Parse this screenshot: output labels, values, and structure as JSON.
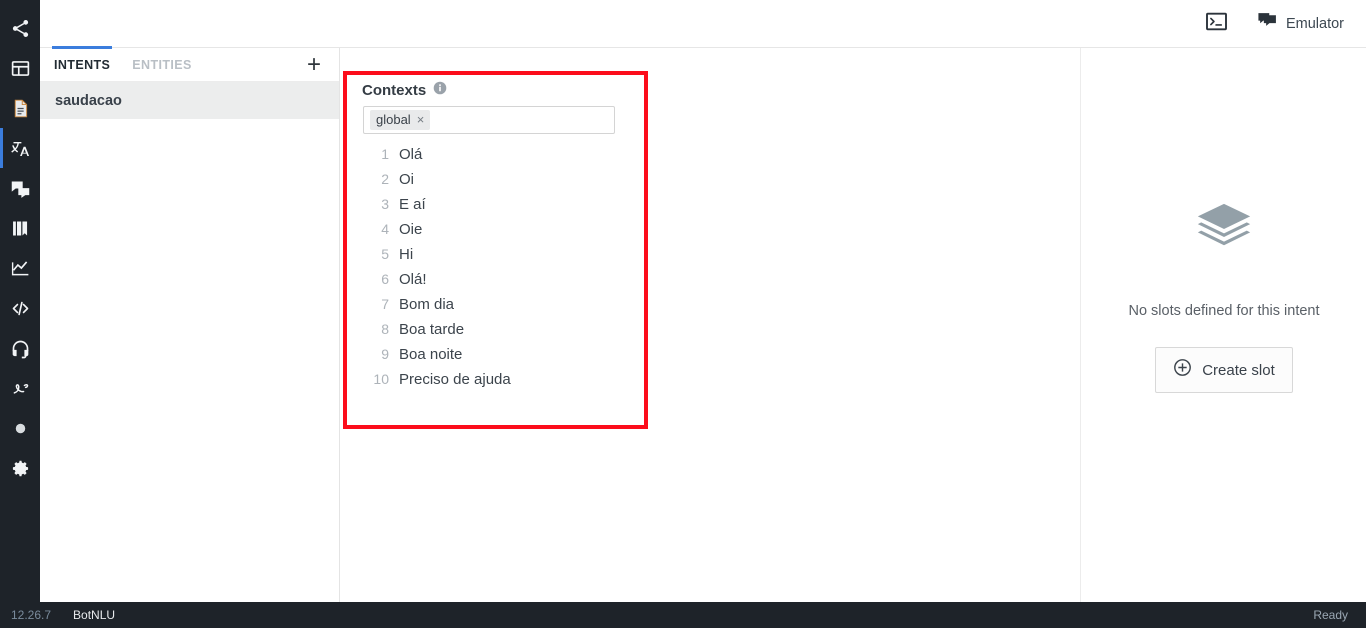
{
  "rail": {
    "items": [
      {
        "name": "share-nodes-icon",
        "title": "Flows"
      },
      {
        "name": "layout-dashboard-icon",
        "title": "Dashboard"
      },
      {
        "name": "document-icon",
        "title": "Documents"
      },
      {
        "name": "translate-icon",
        "title": "NLU",
        "active": true
      },
      {
        "name": "chat-bubbles-icon",
        "title": "Conversations"
      },
      {
        "name": "book-icon",
        "title": "Knowledge"
      },
      {
        "name": "analytics-chart-icon",
        "title": "Analytics"
      },
      {
        "name": "code-brackets-icon",
        "title": "Code"
      },
      {
        "name": "headset-icon",
        "title": "Support"
      },
      {
        "name": "signature-icon",
        "title": "Signature"
      },
      {
        "name": "circle-icon",
        "title": "Status"
      },
      {
        "name": "gear-icon",
        "title": "Settings"
      }
    ]
  },
  "topbar": {
    "console_icon": "terminal-icon",
    "emulator_icon": "chat-emulator-icon",
    "emulator_label": "Emulator"
  },
  "listpanel": {
    "tabs": [
      {
        "label": "INTENTS",
        "active": true
      },
      {
        "label": "ENTITIES",
        "active": false
      }
    ],
    "add_label": "+",
    "intents": [
      {
        "label": "saudacao",
        "selected": true
      }
    ]
  },
  "editor": {
    "contexts_title": "Contexts",
    "info_icon": "info-icon",
    "context_chips": [
      {
        "label": "global",
        "remove": "×"
      }
    ],
    "phrases": [
      {
        "num": "1",
        "text": "Olá"
      },
      {
        "num": "2",
        "text": "Oi"
      },
      {
        "num": "3",
        "text": "E aí"
      },
      {
        "num": "4",
        "text": "Oie"
      },
      {
        "num": "5",
        "text": "Hi"
      },
      {
        "num": "6",
        "text": "Olá!"
      },
      {
        "num": "7",
        "text": "Bom dia"
      },
      {
        "num": "8",
        "text": "Boa tarde"
      },
      {
        "num": "9",
        "text": "Boa noite"
      },
      {
        "num": "10",
        "text": "Preciso de ajuda"
      }
    ]
  },
  "annotation": {
    "color": "#fc0d1b",
    "shape": "rectangle"
  },
  "slots": {
    "empty_icon": "layers-stack-icon",
    "empty_message": "No slots defined for this intent",
    "create_icon": "plus-circle-icon",
    "create_label": "Create slot"
  },
  "statusbar": {
    "version": "12.26.7",
    "project": "BotNLU",
    "status": "Ready"
  },
  "colors": {
    "rail_bg": "#1e2329",
    "accent_blue": "#3b7ddd",
    "annotation_red": "#fc0d1b",
    "selected_row": "#eceded"
  }
}
